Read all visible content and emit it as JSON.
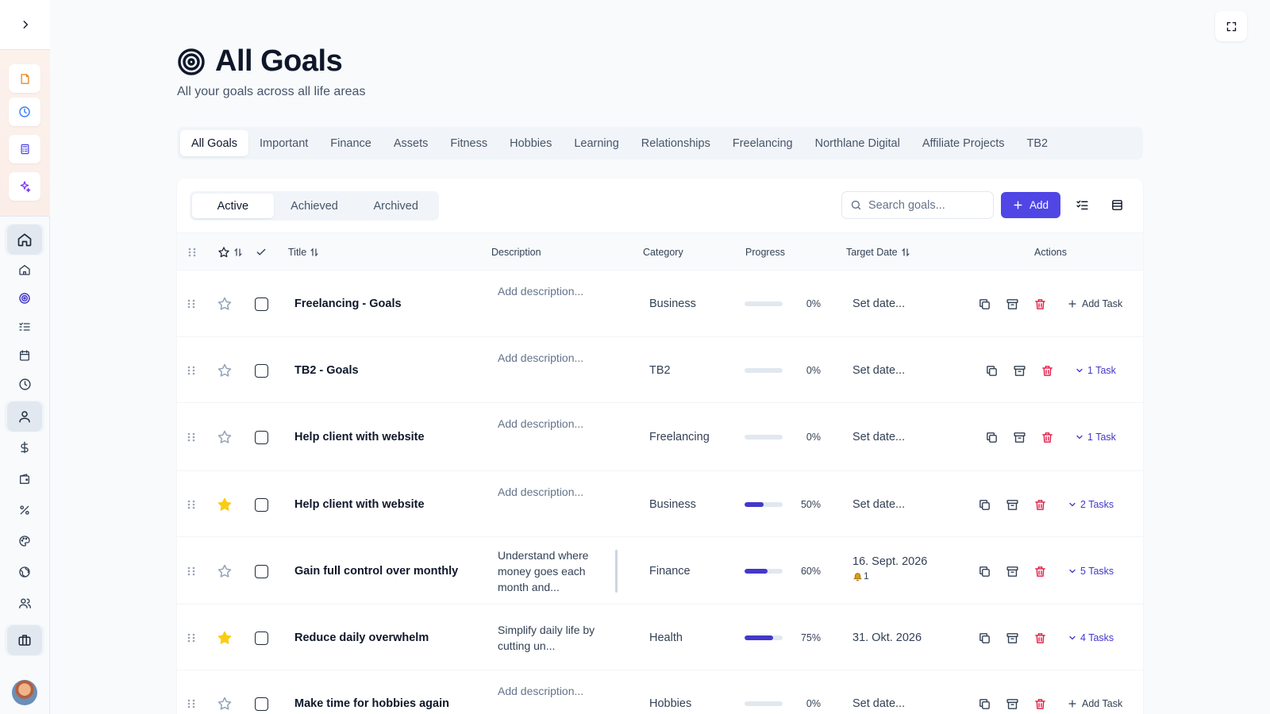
{
  "header": {
    "title": "All Goals",
    "subtitle": "All your goals across all life areas"
  },
  "tabs": [
    {
      "label": "All Goals",
      "active": true
    },
    {
      "label": "Important"
    },
    {
      "label": "Finance"
    },
    {
      "label": "Assets"
    },
    {
      "label": "Fitness"
    },
    {
      "label": "Hobbies"
    },
    {
      "label": "Learning"
    },
    {
      "label": "Relationships"
    },
    {
      "label": "Freelancing"
    },
    {
      "label": "Northlane Digital"
    },
    {
      "label": "Affiliate Projects"
    },
    {
      "label": "TB2"
    }
  ],
  "status_tabs": {
    "active": "Active",
    "achieved": "Achieved",
    "archived": "Archived"
  },
  "toolbar": {
    "search_placeholder": "Search goals...",
    "add_label": "Add"
  },
  "columns": {
    "title": "Title",
    "description": "Description",
    "category": "Category",
    "progress": "Progress",
    "target_date": "Target Date",
    "actions": "Actions"
  },
  "rows": [
    {
      "title": "Freelancing - Goals",
      "description": "Add description...",
      "description_is_placeholder": true,
      "category": "Business",
      "progress": 0,
      "progress_label": "0%",
      "target_date": "Set date...",
      "starred": false,
      "tasks_label": "Add Task",
      "has_tasks": false
    },
    {
      "title": "TB2 - Goals",
      "description": "Add description...",
      "description_is_placeholder": true,
      "category": "TB2",
      "progress": 0,
      "progress_label": "0%",
      "target_date": "Set date...",
      "starred": false,
      "tasks_label": "1 Task",
      "has_tasks": true
    },
    {
      "title": "Help client with website",
      "description": "Add description...",
      "description_is_placeholder": true,
      "category": "Freelancing",
      "progress": 0,
      "progress_label": "0%",
      "target_date": "Set date...",
      "starred": false,
      "tasks_label": "1 Task",
      "has_tasks": true
    },
    {
      "title": "Help client with website",
      "description": "Add description...",
      "description_is_placeholder": true,
      "category": "Business",
      "progress": 50,
      "progress_label": "50%",
      "target_date": "Set date...",
      "starred": true,
      "tasks_label": "2 Tasks",
      "has_tasks": true
    },
    {
      "title": "Gain full control over monthly spending",
      "description_lines": [
        "Understand where",
        "money goes each",
        "month and..."
      ],
      "description_is_placeholder": false,
      "category": "Finance",
      "progress": 60,
      "progress_label": "60%",
      "target_date": "16. Sept. 2026",
      "reminder_count": "1",
      "starred": false,
      "tasks_label": "5 Tasks",
      "has_tasks": true
    },
    {
      "title": "Reduce daily overwhelm",
      "description_lines": [
        "Simplify daily life by",
        "cutting un..."
      ],
      "description_is_placeholder": false,
      "category": "Health",
      "progress": 75,
      "progress_label": "75%",
      "target_date": "31. Okt. 2026",
      "starred": true,
      "tasks_label": "4 Tasks",
      "has_tasks": true
    },
    {
      "title": "Make time for hobbies again",
      "description": "Add description...",
      "description_is_placeholder": true,
      "category": "Hobbies",
      "progress": 0,
      "progress_label": "0%",
      "target_date": "Set date...",
      "starred": false,
      "tasks_label": "Add Task",
      "has_tasks": false
    }
  ],
  "colors": {
    "accent": "#4f46e5",
    "progress_fill": "#4338ca",
    "star_filled": "#facc15",
    "delete": "#e11d48"
  },
  "icons": {
    "sidebar_quick": [
      "note-icon",
      "clock-icon",
      "calculator-icon",
      "sparkles-icon"
    ],
    "sidebar_nav": [
      "home-icon",
      "home-outline-icon",
      "target-icon",
      "list-check-icon",
      "calendar-icon",
      "clock-icon",
      "user-icon",
      "dollar-icon",
      "wallet-icon",
      "percent-tag-icon",
      "palette-icon",
      "globe-icon",
      "users-icon",
      "briefcase-icon"
    ]
  }
}
